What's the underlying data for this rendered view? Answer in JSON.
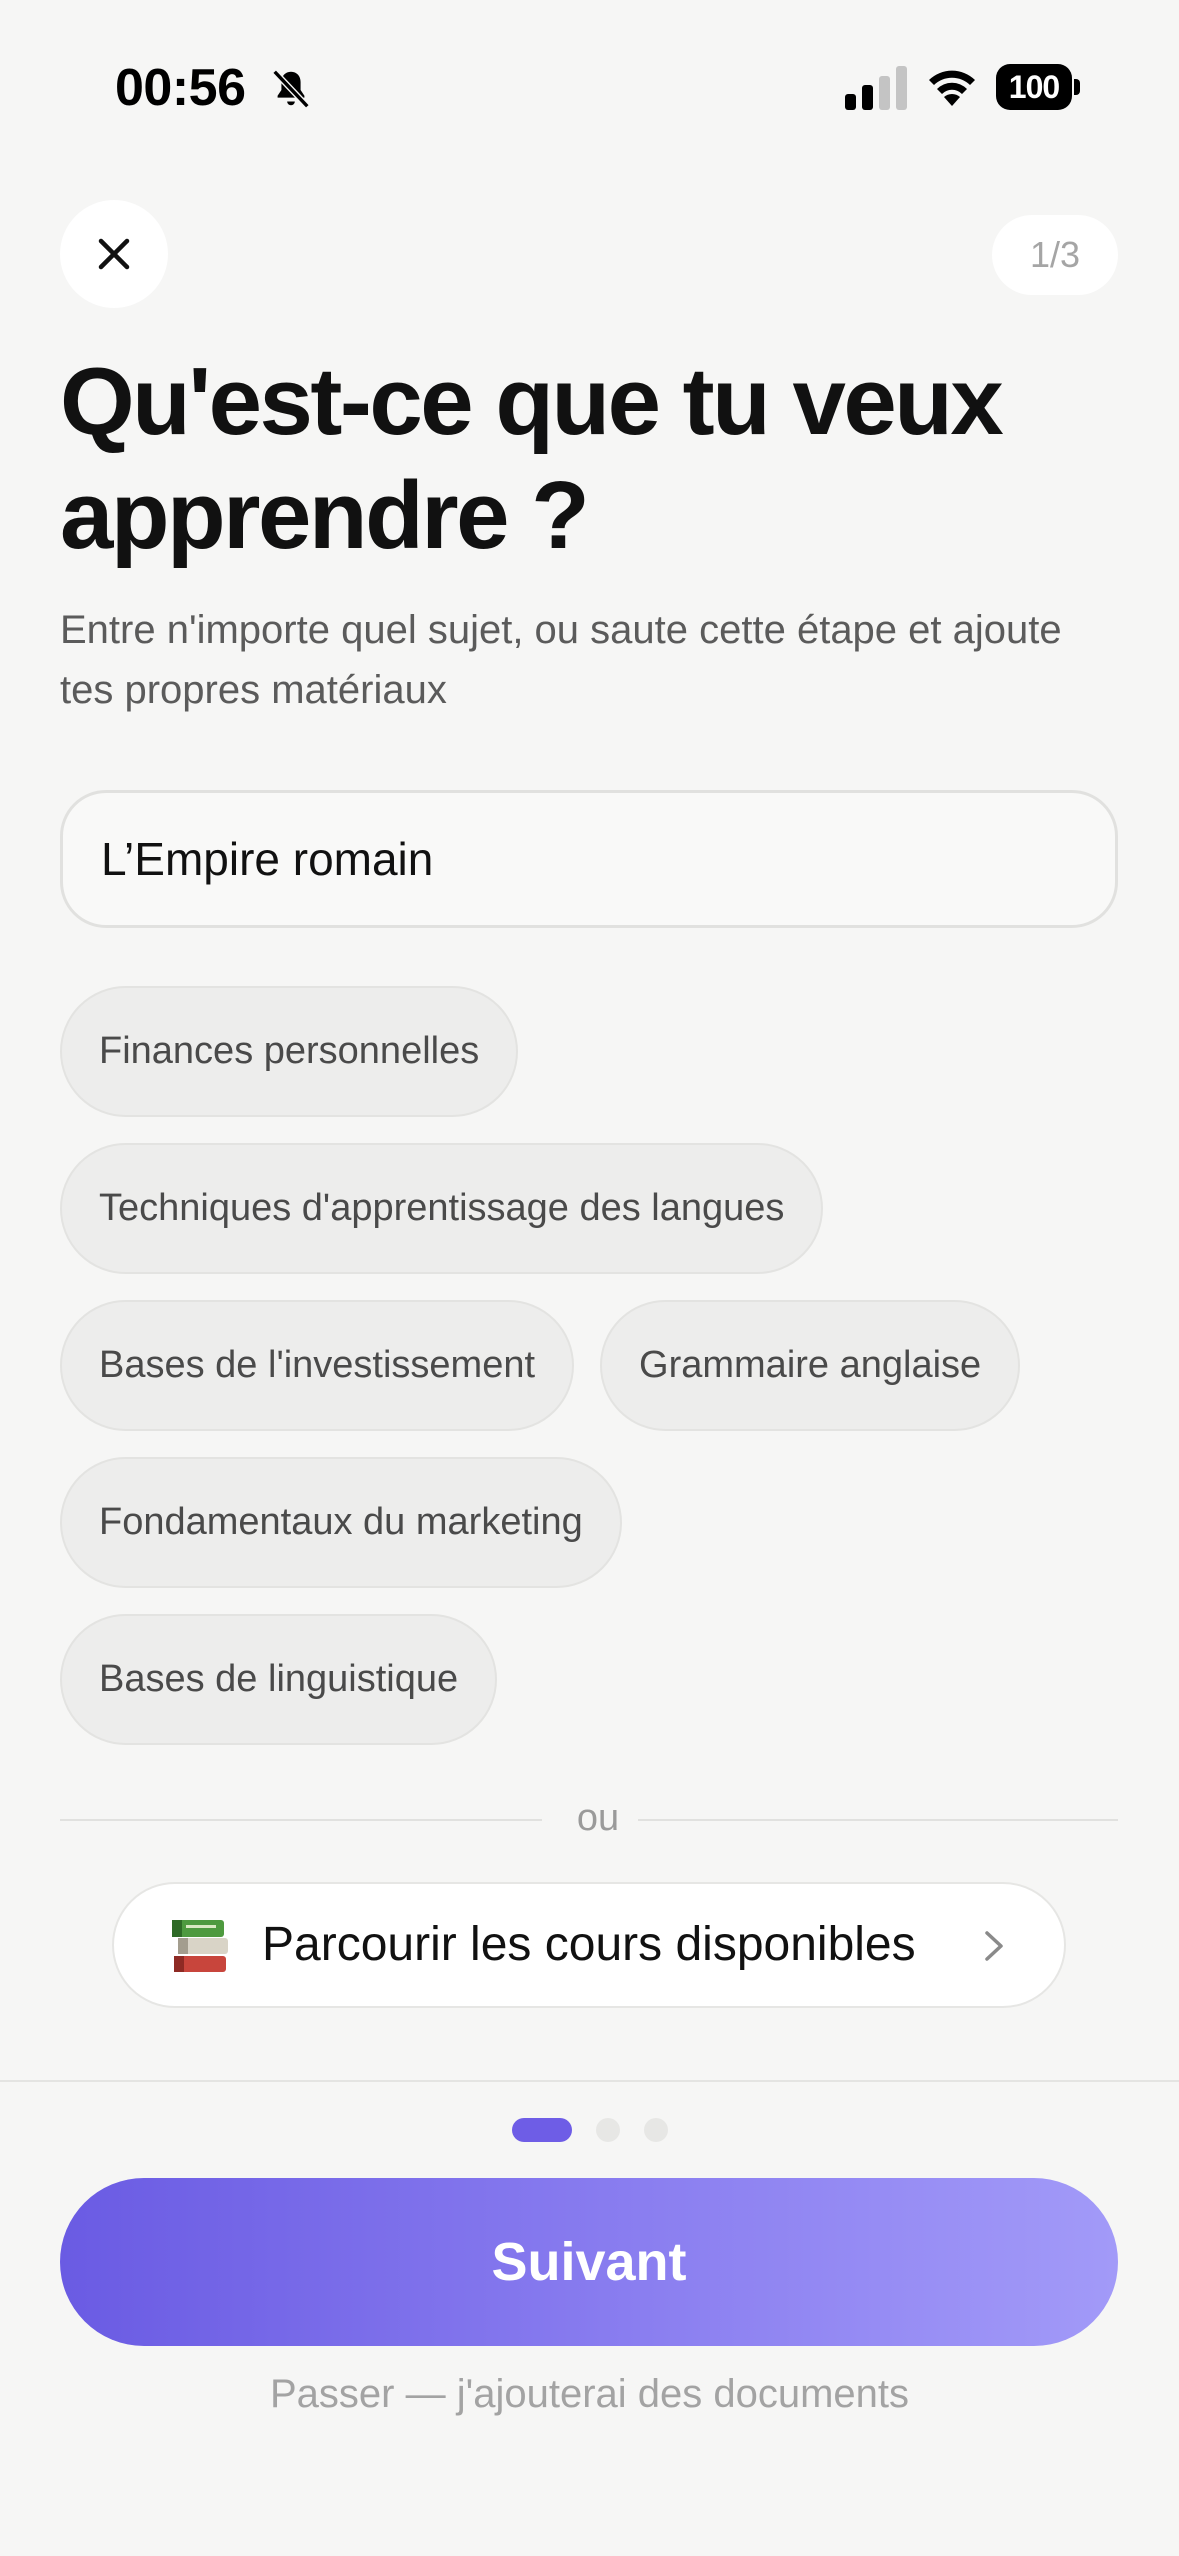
{
  "status_bar": {
    "time": "00:56",
    "battery": "100",
    "icons": [
      "bell-slash-icon",
      "cellular-signal-icon",
      "wifi-icon",
      "battery-icon"
    ]
  },
  "header": {
    "close_icon": "close-icon",
    "step": "1/3",
    "title": "Qu'est-ce que tu veux apprendre ?",
    "subtitle": "Entre n'importe quel sujet, ou saute cette étape et ajoute tes propres matériaux"
  },
  "topic_input": {
    "value": "L’Empire romain"
  },
  "suggestions": [
    [
      "Finances personnelles"
    ],
    [
      "Techniques d'apprentissage des langues"
    ],
    [
      "Bases de l'investissement",
      "Grammaire anglaise"
    ],
    [
      "Fondamentaux du marketing"
    ],
    [
      "Bases de linguistique"
    ]
  ],
  "divider_text": "ou",
  "browse": {
    "icon": "books-emoji",
    "label": "Parcourir les cours disponibles"
  },
  "pagination": {
    "current": 1,
    "total": 3
  },
  "footer": {
    "next_label": "Suivant",
    "skip_label": "Passer — j'ajouterai des documents"
  },
  "colors": {
    "accent": "#6e5de6",
    "background": "#f6f6f5"
  }
}
